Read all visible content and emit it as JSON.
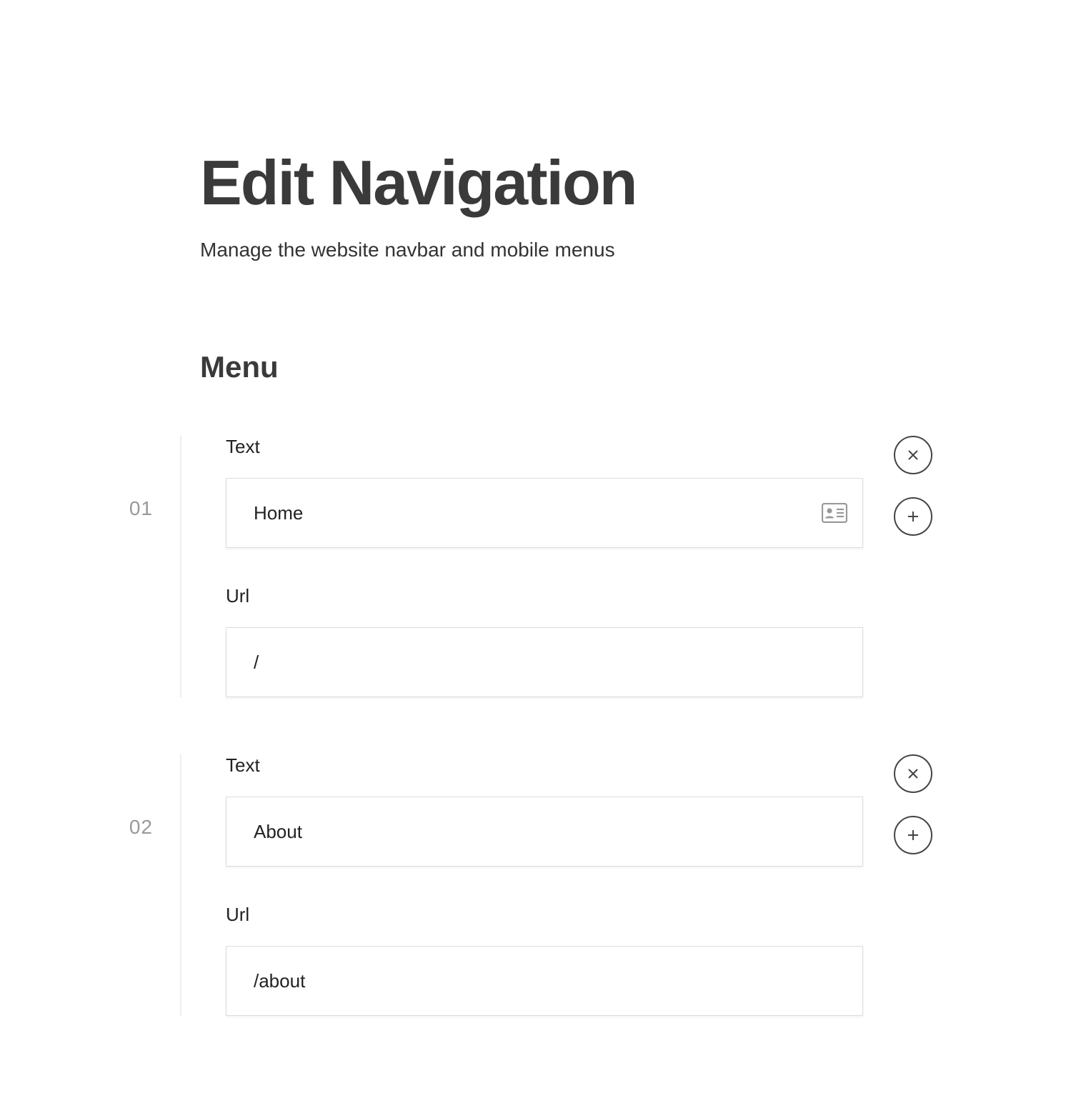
{
  "header": {
    "title": "Edit Navigation",
    "subtitle": "Manage the website navbar and mobile menus"
  },
  "section": {
    "title": "Menu"
  },
  "labels": {
    "text": "Text",
    "url": "Url"
  },
  "items": [
    {
      "index": "01",
      "text": "Home",
      "url": "/",
      "show_suffix_icon": true
    },
    {
      "index": "02",
      "text": "About",
      "url": "/about",
      "show_suffix_icon": false
    }
  ]
}
